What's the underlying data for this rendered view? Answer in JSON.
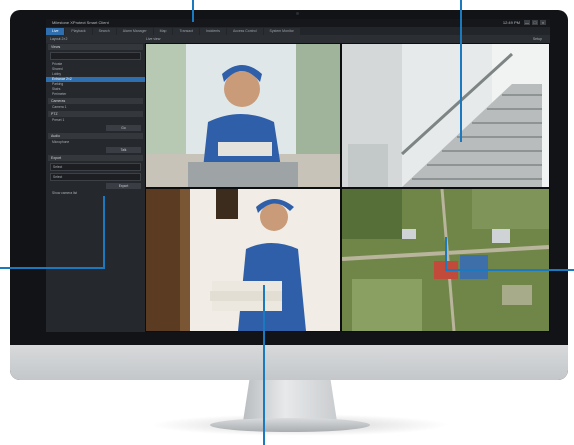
{
  "app": {
    "title": "Milestone XProtect Smart Client",
    "clock": "12:49 PM",
    "window_controls": [
      "—",
      "□",
      "×"
    ]
  },
  "tabs": [
    {
      "label": "Live",
      "active": true
    },
    {
      "label": "Playback",
      "active": false
    },
    {
      "label": "Search",
      "active": false
    },
    {
      "label": "Alarm Manager",
      "active": false
    },
    {
      "label": "Map",
      "active": false
    },
    {
      "label": "Transact",
      "active": false
    },
    {
      "label": "Incidents",
      "active": false
    },
    {
      "label": "Access Control",
      "active": false
    },
    {
      "label": "System Monitor",
      "active": false
    }
  ],
  "toolbar": {
    "left": "Layout 2×2",
    "mid": "Live view",
    "right": "Setup"
  },
  "sidebar": {
    "views_header": "Views",
    "tree_items": [
      {
        "label": "Private",
        "selected": false
      },
      {
        "label": "Shared",
        "selected": false
      },
      {
        "label": "Lobby",
        "selected": false
      },
      {
        "label": "Entrance 2×2",
        "selected": true
      },
      {
        "label": "Parking",
        "selected": false
      },
      {
        "label": "Stairs",
        "selected": false
      },
      {
        "label": "Perimeter",
        "selected": false
      }
    ],
    "cameras_header": "Cameras",
    "cameras_item": "Camera 1",
    "ptz_header": "PTZ",
    "ptz_item": "Preset 1",
    "ptz_button": "Go",
    "audio_header": "Audio",
    "audio_item": "Microphone",
    "audio_button": "Talk",
    "export_header": "Export",
    "export_select": "Select",
    "export_button": "Export",
    "footer_option": "Show camera list"
  },
  "colors": {
    "accent": "#2f6fb0",
    "callout": "#1a79bf",
    "bezel": "#111316"
  }
}
